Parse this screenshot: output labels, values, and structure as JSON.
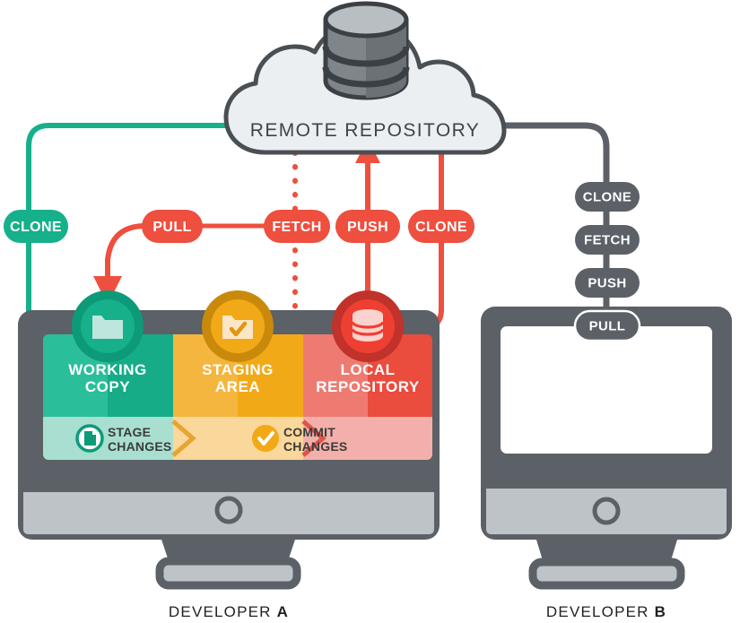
{
  "diagram": {
    "title_visible": false,
    "type": "git-workflow-diagram"
  },
  "remote": {
    "label": "REMOTE REPOSITORY",
    "icon": "database-cylinder-icon",
    "cloud_fill": "#ECEFF1",
    "cloud_stroke": "#4A4F54"
  },
  "developer_a": {
    "caption_prefix": "DEVELOPER ",
    "caption_bold": "A",
    "zones": [
      {
        "label_line1": "WORKING",
        "label_line2": "COPY",
        "color": "#2BBE9B",
        "color_dark": "#15AC87",
        "icon": "folder-icon",
        "icon_ring": "#0D9A79",
        "icon_fill": "#16B08B"
      },
      {
        "label_line1": "STAGING",
        "label_line2": "AREA",
        "color": "#F5B63F",
        "color_dark": "#F2A917",
        "icon": "folder-check-icon",
        "icon_ring": "#C98A0B",
        "icon_fill": "#F2A917"
      },
      {
        "label_line1": "LOCAL",
        "label_line2": "REPOSITORY",
        "color": "#EE7B72",
        "color_dark": "#EA4C3E",
        "icon": "database-icon",
        "icon_ring": "#C0322A",
        "icon_fill": "#EE3F32"
      }
    ],
    "actions": [
      {
        "label_line1": "STAGE",
        "label_line2": "CHANGES",
        "icon": "stage-file-icon",
        "icon_color": "#0D9A79"
      },
      {
        "label_line1": "COMMIT",
        "label_line2": "CHANGES",
        "icon": "commit-check-icon",
        "icon_color": "#F2A917"
      }
    ]
  },
  "developer_b": {
    "caption_prefix": "DEVELOPER ",
    "caption_bold": "B",
    "pill_stack": [
      {
        "label": "CLONE"
      },
      {
        "label": "FETCH"
      },
      {
        "label": "PUSH"
      },
      {
        "label": "PULL"
      }
    ],
    "pill_color": "#5B6166"
  },
  "operations": [
    {
      "id": "clone-left",
      "label": "CLONE",
      "color": "#16B08B",
      "style": "solid"
    },
    {
      "id": "pull",
      "label": "PULL",
      "color": "#EE4F3E",
      "style": "solid"
    },
    {
      "id": "fetch",
      "label": "FETCH",
      "color": "#EE4F3E",
      "style": "dotted"
    },
    {
      "id": "push",
      "label": "PUSH",
      "color": "#EE4F3E",
      "style": "solid"
    },
    {
      "id": "clone-right",
      "label": "CLONE",
      "color": "#EE4F3E",
      "style": "solid"
    }
  ],
  "colors": {
    "monitor_body": "#5B6166",
    "monitor_bezel_light": "#BDC3C7",
    "teal": "#16B08B",
    "amber": "#F2A917",
    "red": "#EE4F3E",
    "grey": "#5B6166",
    "white": "#FFFFFF"
  }
}
